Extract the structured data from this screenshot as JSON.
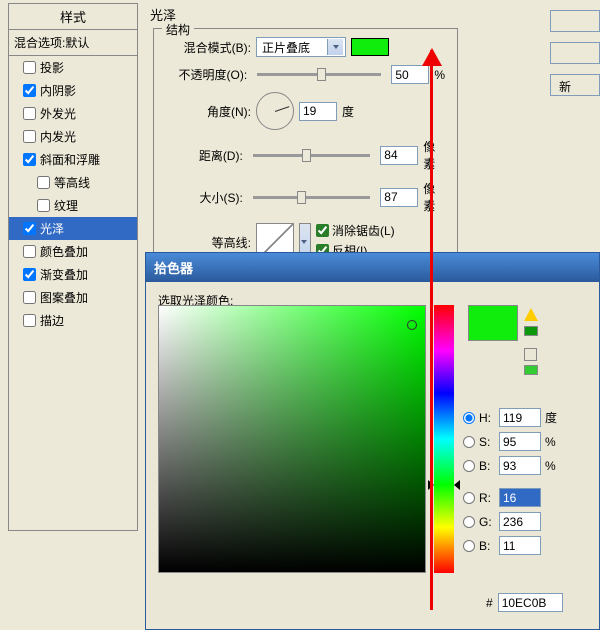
{
  "left_panel": {
    "header": "样式",
    "blend_default": "混合选项:默认",
    "items": [
      {
        "label": "投影",
        "checked": false,
        "indented": false,
        "selected": false
      },
      {
        "label": "内阴影",
        "checked": true,
        "indented": false,
        "selected": false
      },
      {
        "label": "外发光",
        "checked": false,
        "indented": false,
        "selected": false
      },
      {
        "label": "内发光",
        "checked": false,
        "indented": false,
        "selected": false
      },
      {
        "label": "斜面和浮雕",
        "checked": true,
        "indented": false,
        "selected": false
      },
      {
        "label": "等高线",
        "checked": false,
        "indented": true,
        "selected": false
      },
      {
        "label": "纹理",
        "checked": false,
        "indented": true,
        "selected": false
      },
      {
        "label": "光泽",
        "checked": true,
        "indented": false,
        "selected": true
      },
      {
        "label": "颜色叠加",
        "checked": false,
        "indented": false,
        "selected": false
      },
      {
        "label": "渐变叠加",
        "checked": true,
        "indented": false,
        "selected": false
      },
      {
        "label": "图案叠加",
        "checked": false,
        "indented": false,
        "selected": false
      },
      {
        "label": "描边",
        "checked": false,
        "indented": false,
        "selected": false
      }
    ]
  },
  "main": {
    "effect_title": "光泽",
    "structure_legend": "结构",
    "blend_mode_label": "混合模式(B):",
    "blend_mode_value": "正片叠底",
    "blend_color": "#10ec0b",
    "opacity_label": "不透明度(O):",
    "opacity_value": "50",
    "opacity_unit": "%",
    "angle_label": "角度(N):",
    "angle_value": "19",
    "angle_unit": "度",
    "distance_label": "距离(D):",
    "distance_value": "84",
    "distance_unit": "像素",
    "size_label": "大小(S):",
    "size_value": "87",
    "size_unit": "像素",
    "contour_label": "等高线:",
    "antialias_label": "消除锯齿(L)",
    "invert_label": "反相(I)"
  },
  "buttons": {
    "new": "新"
  },
  "picker": {
    "title": "拾色器",
    "select_label": "选取光泽颜色:",
    "h_label": "H:",
    "h_val": "119",
    "h_unit": "度",
    "s_label": "S:",
    "s_val": "95",
    "s_unit": "%",
    "b_label": "B:",
    "b_val": "93",
    "b_unit": "%",
    "r_label": "R:",
    "r_val": "16",
    "g_label": "G:",
    "g_val": "236",
    "bb_label": "B:",
    "bb_val": "11",
    "hash": "#",
    "hex_val": "10EC0B"
  }
}
